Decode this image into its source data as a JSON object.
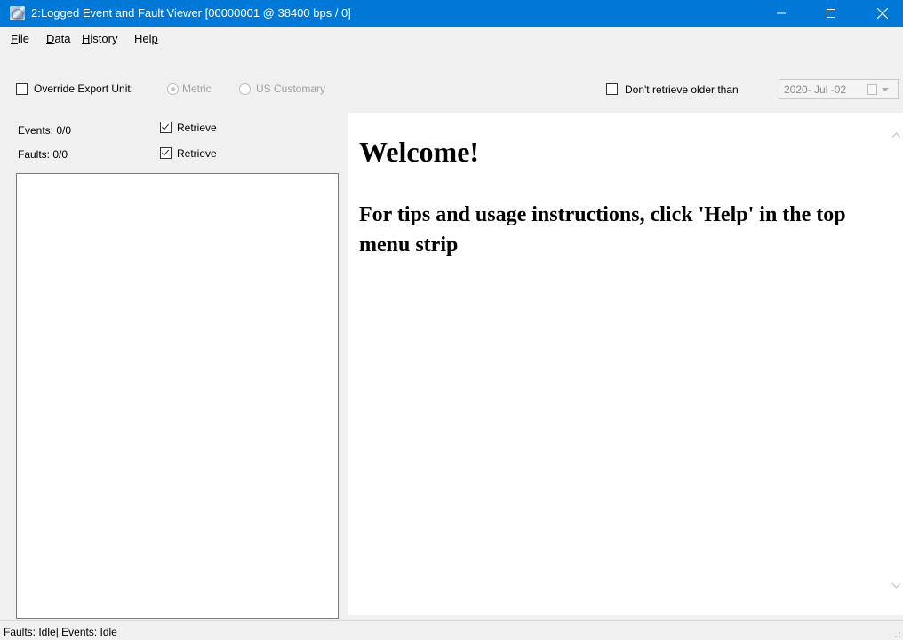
{
  "window": {
    "title": "2:Logged Event and Fault Viewer [00000001 @ 38400 bps / 0]",
    "accent_color": "#0078d7",
    "icon": "app-icon"
  },
  "menu": {
    "items": [
      {
        "label": "File",
        "mnemonic": "F"
      },
      {
        "label": "Data",
        "mnemonic": "D"
      },
      {
        "label": "History",
        "mnemonic": "H"
      },
      {
        "label": "Help",
        "mnemonic": "p"
      }
    ]
  },
  "toolbar": {
    "override_export_unit": {
      "label": "Override Export Unit:",
      "checked": false
    },
    "unit_options": [
      {
        "label": "Metric",
        "selected": true,
        "enabled": false
      },
      {
        "label": "US Customary",
        "selected": false,
        "enabled": false
      }
    ],
    "dont_retrieve_older": {
      "label": "Don't retrieve older than",
      "checked": false
    },
    "date_value": "2020- Jul -02"
  },
  "left_panel": {
    "events_label": "Events: 0/0",
    "events_retrieve": {
      "label": "Retrieve",
      "checked": true
    },
    "faults_label": "Faults: 0/0",
    "faults_retrieve": {
      "label": "Retrieve",
      "checked": true
    },
    "list_items": []
  },
  "content": {
    "heading": "Welcome!",
    "message": "For tips and usage instructions, click 'Help' in the top menu strip"
  },
  "status_bar": {
    "text": "Faults: Idle| Events: Idle"
  }
}
